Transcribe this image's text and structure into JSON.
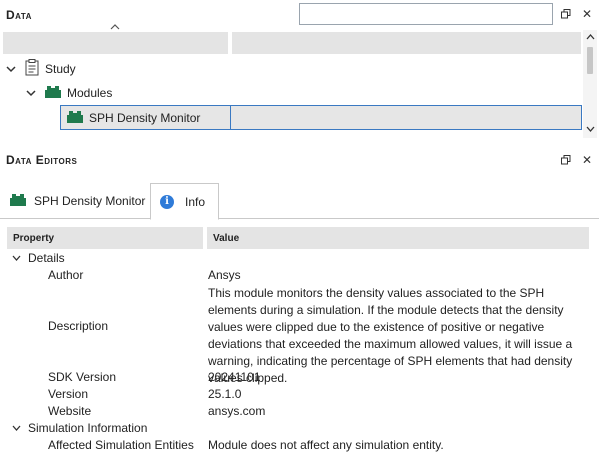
{
  "data_panel": {
    "title": "Data",
    "search_value": "",
    "tree": [
      {
        "label": "Study",
        "icon": "clipboard-icon"
      },
      {
        "label": "Modules",
        "icon": "module-blocks-icon"
      },
      {
        "label": "SPH Density Monitor",
        "icon": "module-blocks-icon",
        "selected": true
      }
    ]
  },
  "editors_panel": {
    "title": "Data Editors",
    "tabs": [
      {
        "label": "SPH Density Monitor",
        "icon": "module-blocks-icon",
        "active": false
      },
      {
        "label": "Info",
        "icon": "info-icon",
        "active": true
      }
    ],
    "table": {
      "headers": {
        "property": "Property",
        "value": "Value"
      },
      "groups": [
        {
          "name": "Details",
          "rows": [
            {
              "property": "Author",
              "value": "Ansys"
            },
            {
              "property": "Description",
              "value": "This module monitors the density values associated to the SPH elements during a simulation. If the module detects that the density values were clipped due to the existence of positive or negative deviations that exceeded the maximum allowed values, it will issue a warning, indicating the percentage of SPH elements that had density values clipped."
            },
            {
              "property": "SDK Version",
              "value": "20241101"
            },
            {
              "property": "Version",
              "value": "25.1.0"
            },
            {
              "property": "Website",
              "value": "ansys.com"
            }
          ]
        },
        {
          "name": "Simulation Information",
          "rows": [
            {
              "property": "Affected Simulation Entities",
              "value": "Module does not affect any simulation entity."
            }
          ]
        }
      ]
    }
  },
  "colors": {
    "accent": "#3a79c2",
    "module_green": "#1f7a4d",
    "info_blue": "#2f7bd8"
  }
}
